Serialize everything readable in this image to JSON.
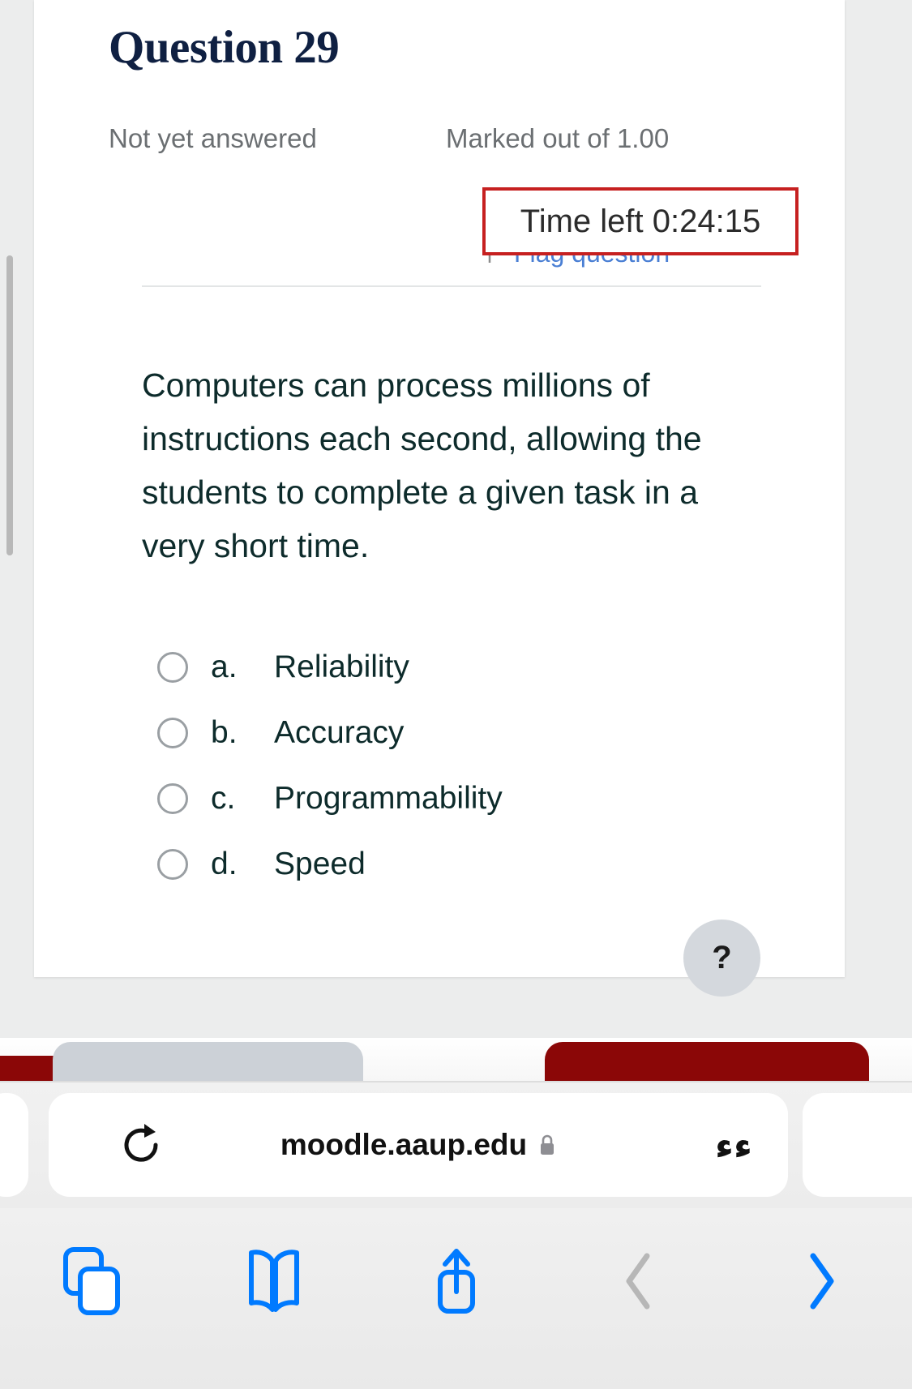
{
  "page": {
    "question": {
      "title": "Question 29",
      "status": "Not yet answered",
      "marks": "Marked out of 1.00",
      "flag_label": "Flag question",
      "body": "Computers can process millions of instructions each second, allowing the students to complete a given task in a very short time.",
      "options": [
        {
          "letter": "a.",
          "text": "Reliability",
          "selected": false
        },
        {
          "letter": "b.",
          "text": "Accuracy",
          "selected": false
        },
        {
          "letter": "c.",
          "text": "Programmability",
          "selected": false
        },
        {
          "letter": "d.",
          "text": "Speed",
          "selected": false
        }
      ],
      "help_label": "?"
    },
    "timer": {
      "label": "Time left 0:24:15",
      "border_color": "#c62020"
    },
    "colors": {
      "title": "#0f2042",
      "status_text": "#6b6f72",
      "body_text": "#0d2b2b",
      "link": "#4a7fd4",
      "tab_maroon": "#8b0707",
      "tab_gray": "#ccd1d7",
      "toolbar_accent": "#007aff",
      "help_bg": "#d4d8dd"
    }
  },
  "browser": {
    "tabs": [
      {
        "name": "tab-maroon-left",
        "color": "#8b0707"
      },
      {
        "name": "tab-gray-active",
        "color": "#ccd1d7"
      },
      {
        "name": "tab-maroon-right",
        "color": "#8b0707"
      }
    ],
    "urlbar": {
      "url": "moodle.aaup.edu",
      "reload_icon": "reload-icon",
      "lock_icon": "lock-icon",
      "text_size_label": "ءء"
    },
    "toolbar": [
      {
        "name": "tabs-overview-button",
        "icon": "tabs-icon",
        "enabled": true
      },
      {
        "name": "bookmarks-button",
        "icon": "book-icon",
        "enabled": true
      },
      {
        "name": "share-button",
        "icon": "share-icon",
        "enabled": true
      },
      {
        "name": "back-button",
        "icon": "chevron-left-icon",
        "enabled": false
      },
      {
        "name": "forward-button",
        "icon": "chevron-right-icon",
        "enabled": true
      }
    ]
  }
}
